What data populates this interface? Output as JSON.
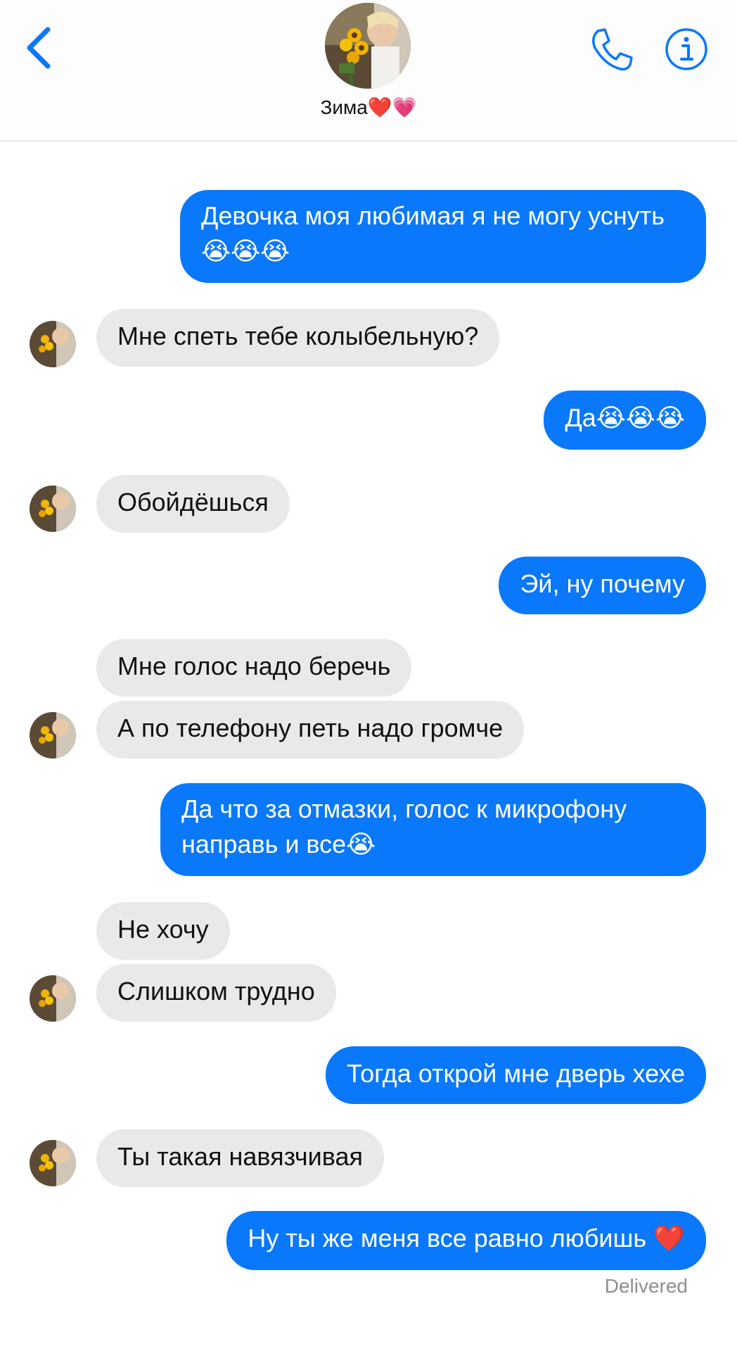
{
  "header": {
    "contact_name": "Зима❤️💗",
    "back_icon": "chevron-left-icon",
    "call_icon": "phone-icon",
    "info_icon": "info-icon",
    "accent_color": "#0a78fb"
  },
  "messages": [
    {
      "from": "me",
      "text_line1": "Девочка моя любимая я не могу уснуть",
      "text_line2": "😭😭😭"
    },
    {
      "from": "them",
      "text": "Мне спеть тебе колыбельную?"
    },
    {
      "from": "me",
      "text": "Да😭😭😭"
    },
    {
      "from": "them",
      "text": "Обойдёшься"
    },
    {
      "from": "me",
      "text": "Эй, ну почему"
    },
    {
      "from": "them",
      "text": "Мне голос надо беречь"
    },
    {
      "from": "them",
      "text": "А по телефону петь надо громче"
    },
    {
      "from": "me",
      "text_line1": "Да что за отмазки, голос к микрофону",
      "text_line2": "направь и все😭"
    },
    {
      "from": "them",
      "text": "Не хочу"
    },
    {
      "from": "them",
      "text": "Слишком трудно"
    },
    {
      "from": "me",
      "text": "Тогда открой мне дверь хехе"
    },
    {
      "from": "them",
      "text": "Ты такая навязчивая"
    },
    {
      "from": "me",
      "text": "Ну ты же меня все равно любишь ❤️"
    }
  ],
  "status": "Delivered"
}
